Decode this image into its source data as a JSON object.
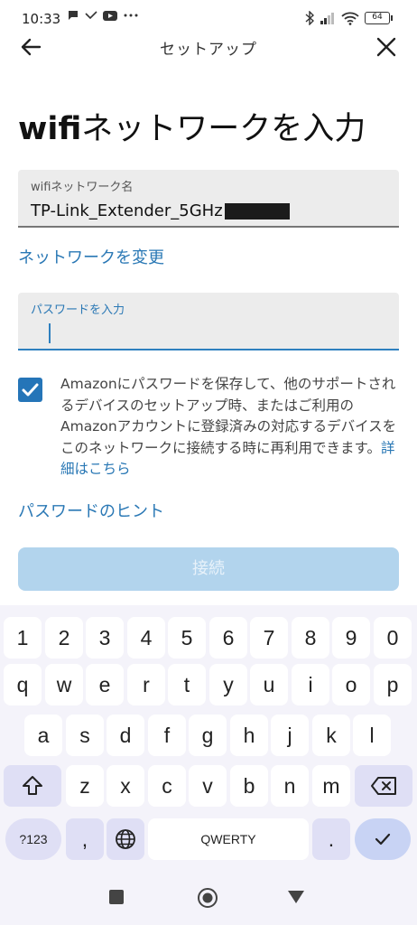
{
  "status_bar": {
    "time": "10:33",
    "battery": "64"
  },
  "header": {
    "title": "セットアップ"
  },
  "page": {
    "title_bold": "wifi",
    "title_rest": "ネットワークを入力"
  },
  "network_field": {
    "label": "wifiネットワーク名",
    "value": "TP-Link_Extender_5GHz"
  },
  "change_network_link": "ネットワークを変更",
  "password_field": {
    "label": "パスワードを入力",
    "value": ""
  },
  "save_option": {
    "checked": true,
    "text": "Amazonにパスワードを保存して、他のサポートされるデバイスのセットアップ時、またはご利用のAmazonアカウントに登録済みの対応するデバイスをこのネットワークに接続する時に再利用できます。",
    "details_link": "詳細はこちら"
  },
  "password_hint_link": "パスワードのヒント",
  "connect_button": "接続",
  "keyboard": {
    "row_numbers": [
      "1",
      "2",
      "3",
      "4",
      "5",
      "6",
      "7",
      "8",
      "9",
      "0"
    ],
    "row_1": [
      "q",
      "w",
      "e",
      "r",
      "t",
      "y",
      "u",
      "i",
      "o",
      "p"
    ],
    "row_2": [
      "a",
      "s",
      "d",
      "f",
      "g",
      "h",
      "j",
      "k",
      "l"
    ],
    "row_3": [
      "z",
      "x",
      "c",
      "v",
      "b",
      "n",
      "m"
    ],
    "symbols_key": "?123",
    "comma_key": ",",
    "space_key": "QWERTY",
    "period_key": "."
  },
  "colors": {
    "accent": "#2a78b5",
    "checkbox": "#2575b8",
    "connect_disabled": "#b2d4ed"
  }
}
